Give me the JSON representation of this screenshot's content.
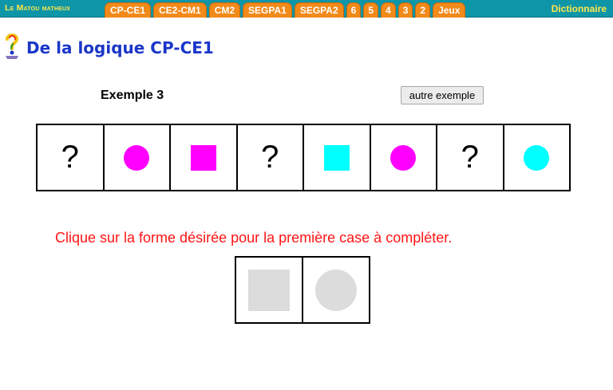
{
  "nav": {
    "brand": "Le Matou matheux",
    "tabs": [
      "CP-CE1",
      "CE2-CM1",
      "CM2",
      "SEGPA1",
      "SEGPA2",
      "6",
      "5",
      "4",
      "3",
      "2",
      "Jeux"
    ],
    "dictionary": "Dictionnaire",
    "colors": {
      "bar": "#0f95a8",
      "tab": "#f28a1a",
      "brand": "#ffe84a"
    }
  },
  "header": {
    "logo_icon": "colored-question-mark-icon",
    "title": "De la logique CP-CE1"
  },
  "example": {
    "label": "Exemple 3",
    "button": "autre exemple"
  },
  "sequence": [
    {
      "kind": "question",
      "text": "?"
    },
    {
      "kind": "circle",
      "color": "#ff00ff"
    },
    {
      "kind": "square",
      "color": "#ff00ff"
    },
    {
      "kind": "question",
      "text": "?"
    },
    {
      "kind": "square",
      "color": "#00ffff"
    },
    {
      "kind": "circle",
      "color": "#ff00ff"
    },
    {
      "kind": "question",
      "text": "?"
    },
    {
      "kind": "circle",
      "color": "#00ffff"
    }
  ],
  "instruction": "Clique sur la forme désirée pour la première case à compléter.",
  "choices": [
    {
      "kind": "square",
      "color": "#dcdcdc"
    },
    {
      "kind": "circle",
      "color": "#dcdcdc"
    }
  ]
}
